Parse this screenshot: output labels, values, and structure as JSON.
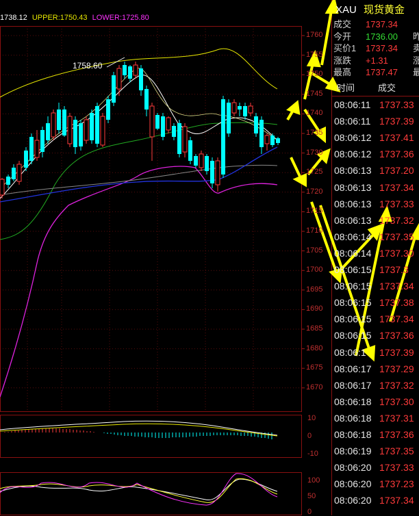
{
  "legend": {
    "mid": "1738.12",
    "upper": "UPPER:1750.43",
    "lower": "LOWER:1725.80",
    "colors": {
      "mid": "#ffffff",
      "upper": "#ffff00",
      "lower": "#ff33ff"
    }
  },
  "chart": {
    "high_annotation": "1758.60",
    "y_axis": [
      "1760",
      "1755",
      "1750",
      "1745",
      "1740",
      "1735",
      "1730",
      "1725",
      "1720",
      "1715",
      "1710",
      "1705",
      "1700",
      "1695",
      "1690",
      "1685",
      "1680",
      "1675",
      "1670"
    ],
    "macd_axis": [
      "10",
      "0",
      "-10"
    ],
    "kdj_axis": [
      "100",
      "50",
      "0"
    ]
  },
  "quote": {
    "symbol": "XAU",
    "name": "现货黄金",
    "rows": [
      {
        "label": "成交",
        "value": "1737.34",
        "color": "#ff3b3b",
        "extra": ""
      },
      {
        "label": "今开",
        "value": "1736.00",
        "color": "#33dd33",
        "extra": "昨"
      },
      {
        "label": "买价1",
        "value": "1737.34",
        "color": "#ff3b3b",
        "extra": "卖"
      },
      {
        "label": "涨跌",
        "value": "+1.31",
        "color": "#ff3b3b",
        "extra": "涨"
      },
      {
        "label": "最高",
        "value": "1737.47",
        "color": "#ff3b3b",
        "extra": "最"
      }
    ],
    "tick_header": {
      "time": "时间",
      "price": "成交"
    },
    "ticks": [
      {
        "time": "08:06:11",
        "price": "1737.33"
      },
      {
        "time": "08:06:11",
        "price": "1737.39"
      },
      {
        "time": "08:06:12",
        "price": "1737.41"
      },
      {
        "time": "08:06:12",
        "price": "1737.36"
      },
      {
        "time": "08:06:13",
        "price": "1737.20"
      },
      {
        "time": "08:06:13",
        "price": "1737.34"
      },
      {
        "time": "08:06:13",
        "price": "1737.33"
      },
      {
        "time": "08:06:13",
        "price": "1737.32"
      },
      {
        "time": "08:06:14",
        "price": "1737.35"
      },
      {
        "time": "08:06:14",
        "price": "1737.30"
      },
      {
        "time": "08:06:15",
        "price": "1737.3"
      },
      {
        "time": "08:06:15",
        "price": "1737.34"
      },
      {
        "time": "08:06:15",
        "price": "1737.38"
      },
      {
        "time": "08:06:15",
        "price": "1737.34"
      },
      {
        "time": "08:06:15",
        "price": "1737.36"
      },
      {
        "time": "08:06:1",
        "price": "1737.39"
      },
      {
        "time": "08:06:17",
        "price": "1737.29"
      },
      {
        "time": "08:06:17",
        "price": "1737.32"
      },
      {
        "time": "08:06:18",
        "price": "1737.30"
      },
      {
        "time": "08:06:18",
        "price": "1737.31"
      },
      {
        "time": "08:06:18",
        "price": "1737.36"
      },
      {
        "time": "08:06:19",
        "price": "1737.35"
      },
      {
        "time": "08:06:20",
        "price": "1737.33"
      },
      {
        "time": "08:06:20",
        "price": "1737.23"
      },
      {
        "time": "08:06:20",
        "price": "1737.34"
      }
    ]
  }
}
